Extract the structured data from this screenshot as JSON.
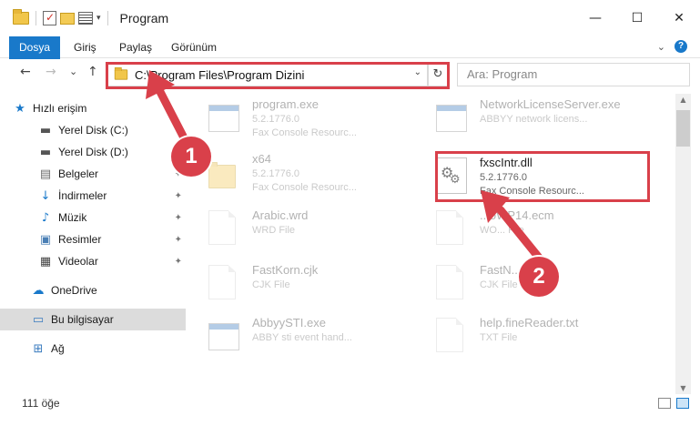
{
  "window": {
    "title": "Program",
    "minimize_glyph": "—",
    "maximize_glyph": "☐",
    "close_glyph": "✕"
  },
  "ribbon": {
    "tabs": [
      "Dosya",
      "Giriş",
      "Paylaş",
      "Görünüm"
    ],
    "help_label": "?"
  },
  "nav": {
    "back": "←",
    "forward": "→",
    "recent": "⌄",
    "up": "↑",
    "address": "C:\\Program Files\\Program Dizini",
    "refresh": "↻",
    "search_placeholder": "Ara: Program"
  },
  "sidebar": {
    "items": [
      {
        "label": "Hızlı erişim",
        "icon": "star-icon"
      },
      {
        "label": "Yerel Disk (C:)",
        "icon": "drive-icon"
      },
      {
        "label": "Yerel Disk (D:)",
        "icon": "drive-icon"
      },
      {
        "label": "Belgeler",
        "icon": "documents-icon"
      },
      {
        "label": "İndirmeler",
        "icon": "download-icon"
      },
      {
        "label": "Müzik",
        "icon": "music-icon"
      },
      {
        "label": "Resimler",
        "icon": "pictures-icon"
      },
      {
        "label": "Videolar",
        "icon": "videos-icon"
      },
      {
        "label": "OneDrive",
        "icon": "cloud-icon"
      },
      {
        "label": "Bu bilgisayar",
        "icon": "computer-icon"
      },
      {
        "label": "Ağ",
        "icon": "network-icon"
      }
    ]
  },
  "files": [
    {
      "name": "program.exe",
      "line2": "5.2.1776.0",
      "line3": "Fax Console Resourc...",
      "icon": "exe-icon"
    },
    {
      "name": "NetworkLicenseServer.exe",
      "line2": "ABBYY network licens...",
      "line3": "",
      "icon": "exe-icon"
    },
    {
      "name": "x64",
      "line2": "5.2.1776.0",
      "line3": "Fax Console Resourc...",
      "icon": "folder-icon"
    },
    {
      "name": "fxscIntr.dll",
      "line2": "5.2.1776.0",
      "line3": "Fax Console Resourc...",
      "icon": "dll-gear-icon"
    },
    {
      "name": "Arabic.wrd",
      "line2": "WRD File",
      "line3": "",
      "icon": "file-icon"
    },
    {
      "name": "...oWP14.ecm",
      "line2": "WO... File",
      "line3": "",
      "icon": "file-icon"
    },
    {
      "name": "FastKorn.cjk",
      "line2": "CJK File",
      "line3": "",
      "icon": "file-icon"
    },
    {
      "name": "FastN...",
      "line2": "CJK File",
      "line3": "",
      "icon": "file-icon"
    },
    {
      "name": "AbbyySTI.exe",
      "line2": "ABBY sti event hand...",
      "line3": "",
      "icon": "exe-icon"
    },
    {
      "name": "help.fineReader.txt",
      "line2": "TXT File",
      "line3": "",
      "icon": "file-icon"
    }
  ],
  "status": {
    "count": "111 öğe"
  },
  "callouts": {
    "one": "1",
    "two": "2"
  },
  "colors": {
    "accent": "#1979ca",
    "highlight": "#d9404a"
  }
}
